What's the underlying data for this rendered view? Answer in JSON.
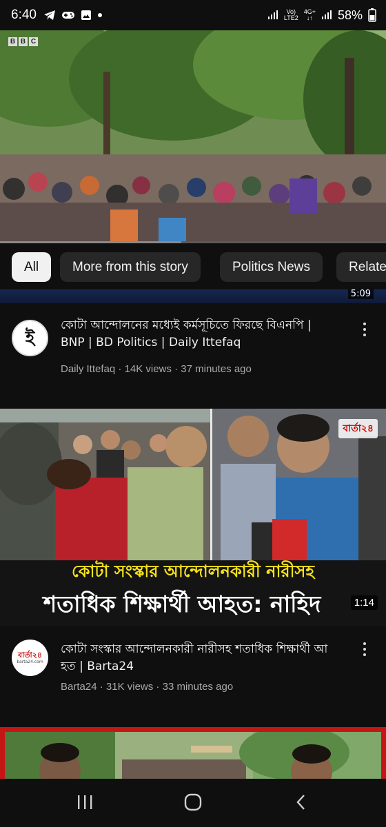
{
  "status_bar": {
    "time": "6:40",
    "network_label_top": "Vo)",
    "network_label_bottom": "LTE2",
    "network_type_top": "4G+",
    "network_type_bottom": "↓↑",
    "battery": "58%"
  },
  "player": {
    "channel_logo": [
      "B",
      "B",
      "C"
    ],
    "progress_fraction": 0.47
  },
  "chips": [
    {
      "label": "All",
      "active": true
    },
    {
      "label": "More from this story",
      "active": false
    },
    {
      "label": "Politics News",
      "active": false
    },
    {
      "label": "Relate",
      "active": false
    }
  ],
  "previous_video": {
    "duration": "5:09"
  },
  "videos": [
    {
      "title": "কোটা আন্দোলনের মধ্যেই কর্মসূচিতে ফিরছে বিএনপি | BNP | BD Politics | Daily Ittefaq",
      "channel": "Daily Ittefaq",
      "views": "14K views",
      "age": "37 minutes ago",
      "avatar_text": "ই"
    },
    {
      "title": "কোটা সংস্কার আন্দোলনকারী নারীসহ শতাধিক শিক্ষার্থী আ হত | Barta24",
      "channel": "Barta24",
      "views": "31K views",
      "age": "33 minutes ago",
      "avatar_text": "বার্তা২৪",
      "avatar_subtext": "barta24.com",
      "thumbnail_caption_line1": "কোটা সংস্কার আন্দোলনকারী নারীসহ",
      "thumbnail_caption_line2": "শতাধিক শিক্ষার্থী আহত: নাহিদ",
      "thumbnail_watermark": "বার্তা২৪",
      "duration": "1:14"
    }
  ],
  "colors": {
    "background": "#0f0f0f",
    "chip": "#272727",
    "chip_active": "#f1f1f1",
    "secondary_text": "#aaaaaa",
    "caption_yellow": "#f7e21a",
    "barta_red": "#c51616"
  },
  "nav": {
    "recents": "recents-icon",
    "home": "home-icon",
    "back": "back-icon"
  }
}
